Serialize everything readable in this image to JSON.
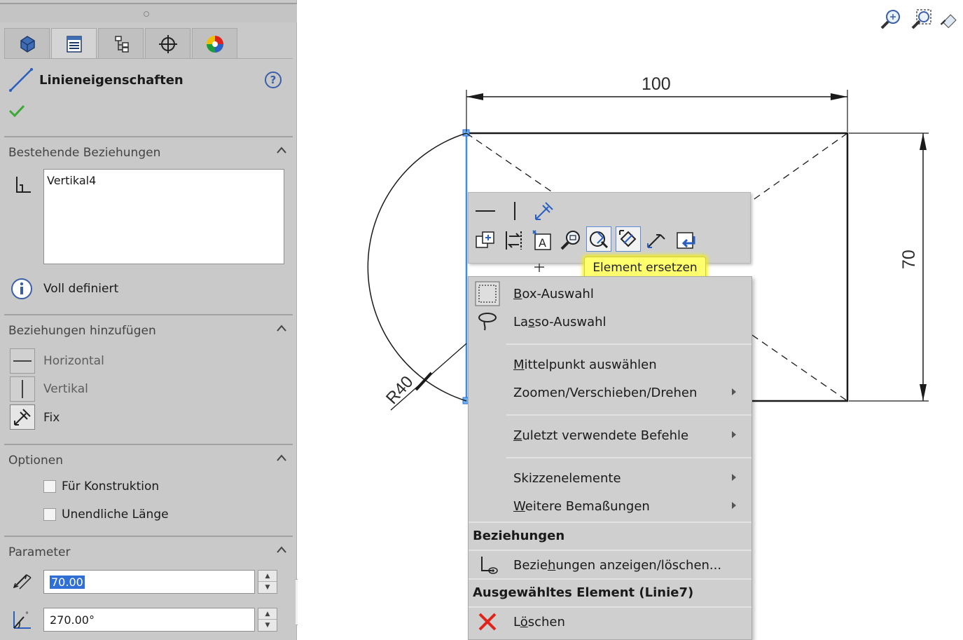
{
  "panel": {
    "title": "Linieneigenschaften",
    "help_label": "?",
    "tabs": [
      {
        "icon": "feature-manager-icon"
      },
      {
        "icon": "property-manager-icon"
      },
      {
        "icon": "configuration-manager-icon"
      },
      {
        "icon": "dimxpert-manager-icon"
      },
      {
        "icon": "display-manager-icon"
      }
    ],
    "existing_relations": {
      "header": "Bestehende Beziehungen",
      "items": [
        "Vertikal4"
      ],
      "status": "Voll definiert"
    },
    "add_relations": {
      "header": "Beziehungen hinzufügen",
      "items": [
        {
          "label": "Horizontal",
          "icon": "horizontal-relation-icon"
        },
        {
          "label": "Vertikal",
          "icon": "vertical-relation-icon"
        },
        {
          "label": "Fix",
          "icon": "fix-relation-icon"
        }
      ]
    },
    "options": {
      "header": "Optionen",
      "items": [
        {
          "label": "Für Konstruktion",
          "checked": false
        },
        {
          "label": "Unendliche Länge",
          "checked": false
        }
      ]
    },
    "parameters": {
      "header": "Parameter",
      "length_value": "70.00",
      "angle_value": "270.00°"
    }
  },
  "sketch": {
    "dim_width": "100",
    "dim_height": "70",
    "dim_radius": "R40"
  },
  "context_toolbar": {
    "tooltip": "Element ersetzen"
  },
  "context_menu": {
    "items": {
      "box_select": {
        "u": "B",
        "rest": "ox-Auswahl"
      },
      "lasso_select": {
        "pre": "La",
        "u": "s",
        "rest": "so-Auswahl"
      },
      "select_midpoint": {
        "u": "M",
        "rest": "ittelpunkt auswählen"
      },
      "zoom_pan_rotate": "Zoomen/Verschieben/Drehen",
      "recent_commands": {
        "u": "Z",
        "rest": "uletzt verwendete Befehle"
      },
      "sketch_entities": "Skizzenelemente",
      "more_dimensions": {
        "u": "W",
        "rest": "eitere Bemaßungen"
      },
      "relations_header": "Beziehungen",
      "show_delete_relations": {
        "pre": "Bezie",
        "u": "h",
        "rest": "ungen anzeigen/löschen..."
      },
      "selected_entity_header": "Ausgewähltes Element (Linie7)",
      "delete": {
        "pre": "L",
        "u": "ö",
        "rest": "schen"
      }
    }
  },
  "colors": {
    "accent_blue": "#2f6fd6",
    "tooltip_yellow": "#ffff6e",
    "delete_red": "#e0241b",
    "check_green": "#3aa935"
  }
}
